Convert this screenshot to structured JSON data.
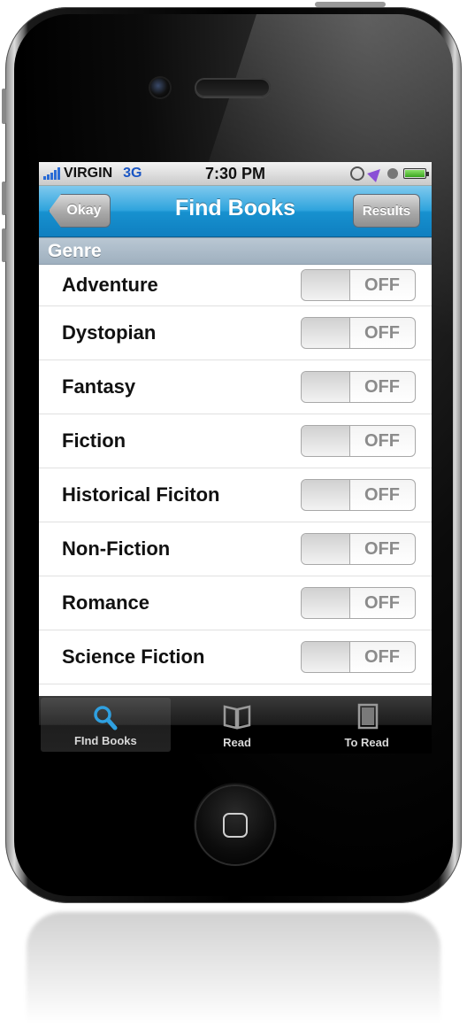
{
  "status_bar": {
    "carrier": "VIRGIN",
    "network": "3G",
    "time": "7:30 PM",
    "icons": [
      "signal-icon",
      "rotation-lock-icon",
      "location-icon",
      "alarm-icon",
      "battery-icon"
    ]
  },
  "nav": {
    "title": "Find Books",
    "back_label": "Okay",
    "results_label": "Results"
  },
  "section": {
    "header": "Genre"
  },
  "genres": [
    {
      "label": "Adventure",
      "state": "OFF"
    },
    {
      "label": "Dystopian",
      "state": "OFF"
    },
    {
      "label": "Fantasy",
      "state": "OFF"
    },
    {
      "label": "Fiction",
      "state": "OFF"
    },
    {
      "label": "Historical Ficiton",
      "state": "OFF"
    },
    {
      "label": "Non-Fiction",
      "state": "OFF"
    },
    {
      "label": "Romance",
      "state": "OFF"
    },
    {
      "label": "Science Fiction",
      "state": "OFF"
    }
  ],
  "tabs": [
    {
      "label": "FInd Books",
      "icon": "magnifier-icon",
      "selected": true
    },
    {
      "label": "Read",
      "icon": "open-book-icon",
      "selected": false
    },
    {
      "label": "To Read",
      "icon": "closed-book-icon",
      "selected": false
    }
  ],
  "colors": {
    "nav_blue": "#1b95d2",
    "section_header": "#a9b8c6",
    "tab_selected_icon": "#2fa0e0",
    "switch_off_text": "#8b8b8b"
  }
}
